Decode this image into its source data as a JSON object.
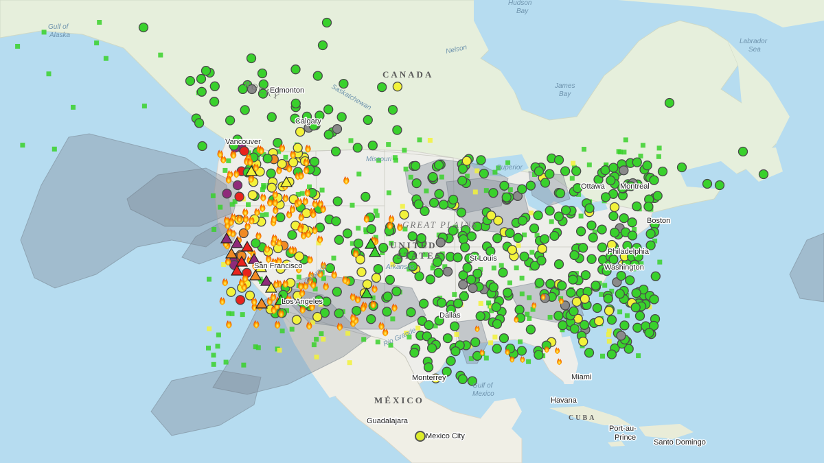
{
  "map": {
    "labels": {
      "countries": [
        {
          "key": "canada",
          "text": "CANADA"
        },
        {
          "key": "usa1",
          "text": "UNITED"
        },
        {
          "key": "usa2",
          "text": "STATES"
        },
        {
          "key": "mexico",
          "text": "MÉXICO"
        },
        {
          "key": "cuba",
          "text": "CUBA"
        }
      ],
      "regions": [
        {
          "key": "rocky",
          "text": "ROCKY"
        },
        {
          "key": "plains",
          "text": "GREAT PLAINS"
        }
      ],
      "water": [
        {
          "key": "gulf_alaska_1",
          "text": "Gulf of"
        },
        {
          "key": "gulf_alaska_2",
          "text": "Alaska"
        },
        {
          "key": "hudson_1",
          "text": "Hudson"
        },
        {
          "key": "hudson_2",
          "text": "Bay"
        },
        {
          "key": "labrador_1",
          "text": "Labrador"
        },
        {
          "key": "labrador_2",
          "text": "Sea"
        },
        {
          "key": "james_1",
          "text": "James"
        },
        {
          "key": "james_2",
          "text": "Bay"
        },
        {
          "key": "gulf_mexico_1",
          "text": "Gulf of"
        },
        {
          "key": "gulf_mexico_2",
          "text": "Mexico"
        },
        {
          "key": "nelson",
          "text": "Nelson"
        },
        {
          "key": "missouri",
          "text": "Missouri"
        },
        {
          "key": "arkansas",
          "text": "Arkansas"
        },
        {
          "key": "rio_grande",
          "text": "Rio Grande"
        },
        {
          "key": "colorado",
          "text": "Colorado"
        },
        {
          "key": "lake_superior",
          "text": "Superior"
        },
        {
          "key": "saskatchewan",
          "text": "Saskatchewan"
        }
      ],
      "cities": [
        {
          "key": "edmonton",
          "text": "Edmonton"
        },
        {
          "key": "calgary",
          "text": "Calgary"
        },
        {
          "key": "vancouver",
          "text": "Vancouver"
        },
        {
          "key": "ottawa",
          "text": "Ottawa"
        },
        {
          "key": "montreal",
          "text": "Montreal"
        },
        {
          "key": "boston",
          "text": "Boston"
        },
        {
          "key": "philadelphia",
          "text": "Philadelphia"
        },
        {
          "key": "washington",
          "text": "Washington"
        },
        {
          "key": "st_louis",
          "text": "St Louis"
        },
        {
          "key": "dallas",
          "text": "Dallas"
        },
        {
          "key": "miami",
          "text": "Miami"
        },
        {
          "key": "havana",
          "text": "Havana"
        },
        {
          "key": "port_au_prince_1",
          "text": "Port-au-"
        },
        {
          "key": "port_au_prince_2",
          "text": "Prince"
        },
        {
          "key": "santo_domingo",
          "text": "Santo Domingo"
        },
        {
          "key": "guadalajara",
          "text": "Guadalajara"
        },
        {
          "key": "mexico_city",
          "text": "Mexico City"
        },
        {
          "key": "monterrey",
          "text": "Monterrey"
        },
        {
          "key": "san_francisco",
          "text": "San Francisco"
        },
        {
          "key": "los_angeles",
          "text": "Los Angeles"
        }
      ]
    },
    "colors": {
      "water": "#b6dcf0",
      "land_canada": "#e6efdc",
      "land_us": "#eeeeea",
      "land_mexico": "#f0efe6",
      "smoke": "#7d8a96",
      "good": "#39d12c",
      "moderate": "#f2f23a",
      "usg": "#f08a24",
      "unhealthy": "#e8241e",
      "very_unhealthy": "#8f2a7a",
      "no_data": "#8a8a8a",
      "fire": "#ff6a00"
    },
    "legend_icons": [
      "aqi-monitor-circle-icon",
      "aqi-sensor-square-icon",
      "temporary-monitor-triangle-icon",
      "fire-icon",
      "smoke-plume-icon"
    ]
  }
}
